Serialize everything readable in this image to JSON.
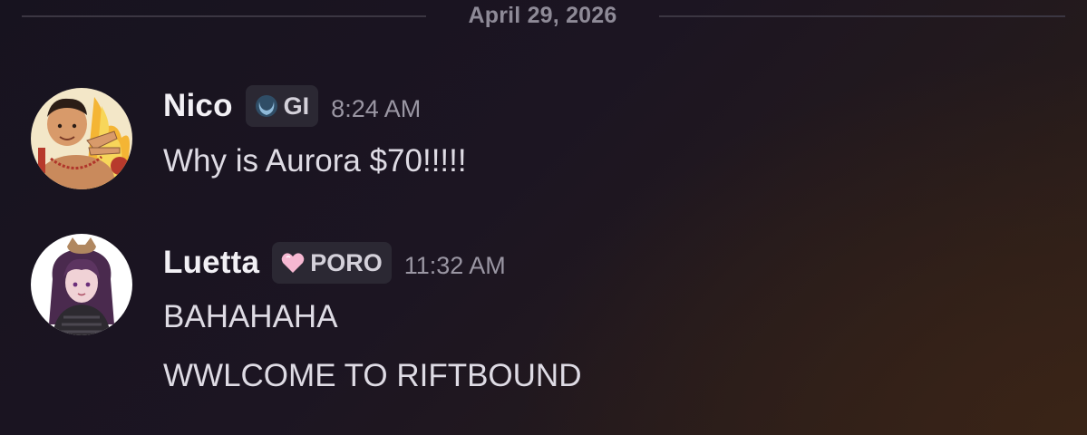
{
  "divider": {
    "date": "April 29, 2026"
  },
  "messages": [
    {
      "username": "Nico",
      "tag": "GI",
      "tag_icon": "crescent-moon-icon",
      "timestamp": "8:24 AM",
      "lines": [
        "Why is Aurora $70!!!!!"
      ],
      "avatar": "cartoon-character-avatar"
    },
    {
      "username": "Luetta",
      "tag": "PORO",
      "tag_icon": "heart-icon",
      "timestamp": "11:32 AM",
      "lines": [
        "BAHAHAHA",
        "WWLCOME TO RIFTBOUND"
      ],
      "avatar": "anime-girl-avatar"
    }
  ],
  "colors": {
    "username": "#f2f0f5",
    "timestamp": "#9a96a3",
    "tag_background": "#2b2833",
    "divider_text": "#8e8a97",
    "heart_pink": "#f6b8d2",
    "moon_blue": "#8fb9d8"
  }
}
